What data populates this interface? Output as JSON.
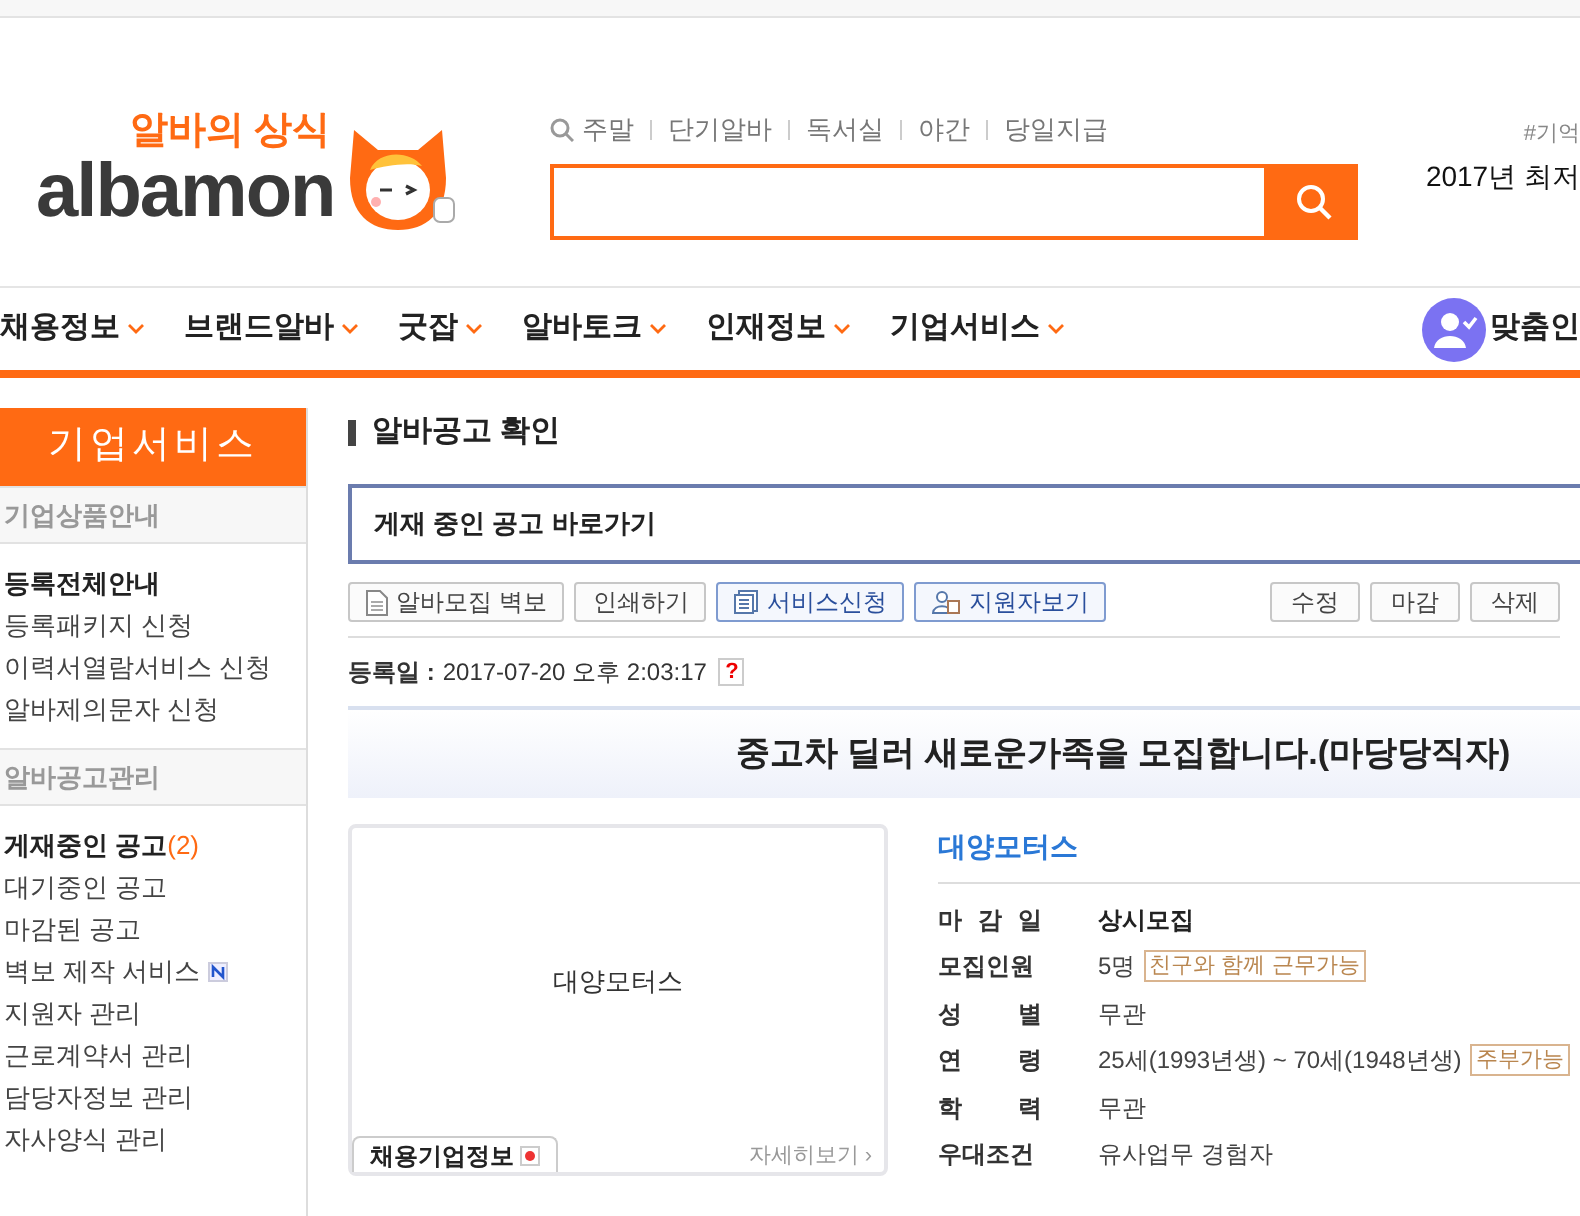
{
  "logo": {
    "tagline": "알바의 상식",
    "wordmark": "albamon"
  },
  "search": {
    "keywords": [
      "주말",
      "단기알바",
      "독서실",
      "야간",
      "당일지급"
    ]
  },
  "promo": {
    "hashtag": "#기억",
    "headline": "2017년 최저"
  },
  "nav": {
    "items": [
      "채용정보",
      "브랜드알바",
      "굿잡",
      "알바토크",
      "인재정보",
      "기업서비스"
    ],
    "custom": "맞춤인"
  },
  "sidebar": {
    "title": "기업서비스",
    "sections": [
      {
        "title": "기업상품안내",
        "items": [
          {
            "label": "등록전체안내",
            "emphasized": true
          },
          {
            "label": "등록패키지 신청",
            "emphasized": false
          },
          {
            "label": "이력서열람서비스 신청",
            "emphasized": false
          },
          {
            "label": "알바제의문자 신청",
            "emphasized": false
          }
        ]
      },
      {
        "title": "알바공고관리",
        "items": [
          {
            "label": "게재중인 공고",
            "count": "(2)",
            "emphasized": true
          },
          {
            "label": "대기중인 공고",
            "emphasized": false
          },
          {
            "label": "마감된 공고",
            "emphasized": false
          },
          {
            "label": "벽보 제작 서비스",
            "new": true,
            "emphasized": false
          },
          {
            "label": "지원자 관리",
            "emphasized": false
          },
          {
            "label": "근로계약서 관리",
            "emphasized": false
          },
          {
            "label": "담당자정보 관리",
            "emphasized": false
          },
          {
            "label": "자사양식 관리",
            "emphasized": false
          }
        ]
      }
    ]
  },
  "page": {
    "title": "알바공고 확인",
    "shortcut": "게재 중인 공고 바로가기",
    "toolbar_left": [
      {
        "label": "알바모집 벽보",
        "kind": "document"
      },
      {
        "label": "인쇄하기",
        "kind": "plain"
      },
      {
        "label": "서비스신청",
        "kind": "service"
      },
      {
        "label": "지원자보기",
        "kind": "applicants"
      }
    ],
    "toolbar_right": [
      "수정",
      "마감",
      "삭제"
    ],
    "registered": {
      "label": "등록일 :",
      "value": "2017-07-20 오후 2:03:17",
      "help": "?"
    },
    "job_title": "중고차 딜러 새로운가족을 모집합니다.(마당당직자)",
    "company_card": {
      "logo_text": "대양모터스",
      "tab": "채용기업정보",
      "more": "자세히보기 ›"
    },
    "company": "대양모터스",
    "details": [
      {
        "label": "마 감 일",
        "value": "상시모집",
        "strong": true
      },
      {
        "label": "모집인원",
        "value": "5명",
        "strong": false,
        "tags": [
          "친구와 함께 근무가능"
        ]
      },
      {
        "label": "성 별",
        "value": "무관",
        "strong": false
      },
      {
        "label": "연 령",
        "value": "25세(1993년생) ~ 70세(1948년생)",
        "strong": false,
        "tags": [
          "주부가능"
        ]
      },
      {
        "label": "학 력",
        "value": "무관",
        "strong": false
      },
      {
        "label": "우대조건",
        "value": "유사업무 경험자",
        "strong": false
      }
    ]
  }
}
